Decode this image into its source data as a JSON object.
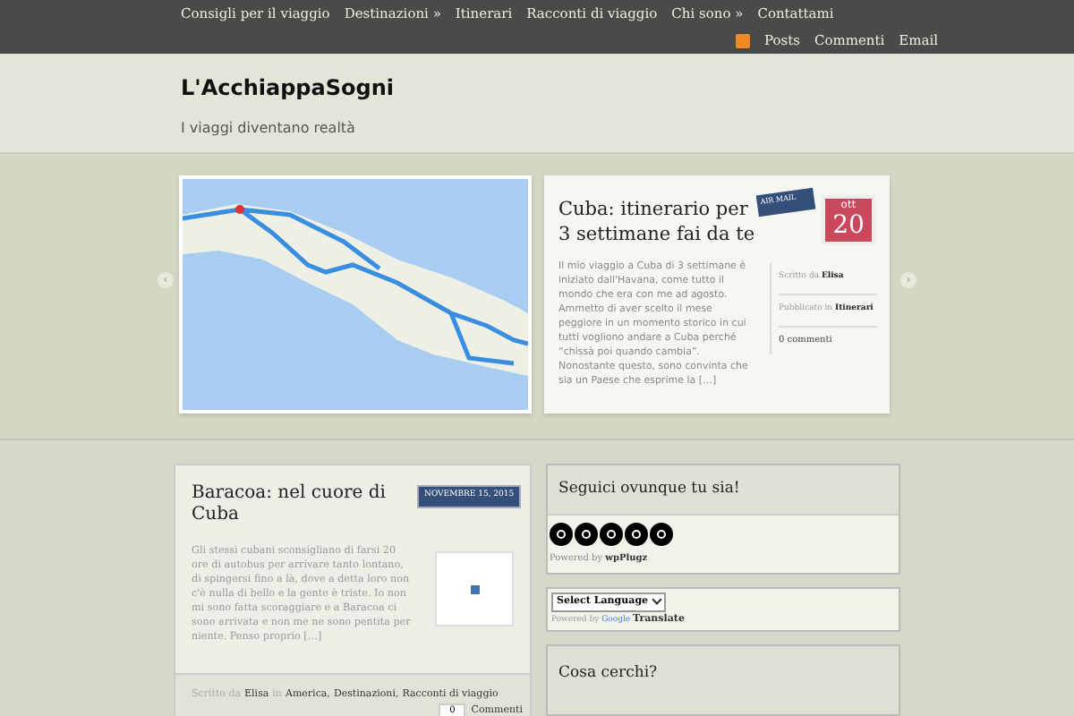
{
  "nav": {
    "items": [
      {
        "label": "Consigli per il viaggio"
      },
      {
        "label": "Destinazioni »"
      },
      {
        "label": "Itinerari"
      },
      {
        "label": "Racconti di viaggio"
      },
      {
        "label": "Chi sono »"
      },
      {
        "label": "Contattami"
      }
    ],
    "feeds": [
      "Posts",
      "Commenti",
      "Email"
    ]
  },
  "header": {
    "title": "L'AcchiappaSogni",
    "tagline": "I viaggi diventano realtà"
  },
  "slider": {
    "title": "Cuba: itinerario per 3 settimane fai da te",
    "airmail": "AIR MAIL",
    "month": "ott",
    "day": "20",
    "excerpt": "Il mio viaggio a Cuba di 3 settimane è iniziato dall'Havana, come tutto il mondo che era con me ad agosto. Ammetto di aver scelto il mese peggiore in un momento storico in cui tutti vogliono andare a Cuba perché “chissà poi quando cambia”. Nonostante questo, sono convinta che sia un Paese che esprime la […]",
    "meta": [
      {
        "label": "Scritto da",
        "value": "Elisa"
      },
      {
        "label": "Pubblicato in",
        "value": "Itinerari"
      }
    ],
    "comments": "0 commenti",
    "prev": "‹",
    "next": "›"
  },
  "post": {
    "title": "Baracoa: nel cuore di Cuba",
    "date": "NOVEMBRE 15, 2015",
    "excerpt": "Gli stessi cubani sconsigliano di farsi 20 ore di autobus per arrivare tanto lontano, di spingersi fino a là, dove a detta loro non c'è nulla di bello e la gente è triste. Io non mi sono fatta scoraggiare e a Baracoa ci sono arrivata e non me ne sono pentita per niente. Penso proprio […]",
    "by": "Scritto da",
    "author": "Elisa",
    "in": "in",
    "categories": [
      "America,",
      "Destinazioni,",
      "Racconti di viaggio"
    ],
    "comment_count": "0",
    "comments_label": "Commenti"
  },
  "sidebar": {
    "follow_title": "Seguici ovunque tu sia!",
    "powered": "Powered by",
    "plugin": "wpPlugz",
    "language": {
      "value": "Select Language",
      "powered": "Powered by",
      "google": "Google",
      "translate": "Translate"
    },
    "search_title": "Cosa cerchi?"
  }
}
